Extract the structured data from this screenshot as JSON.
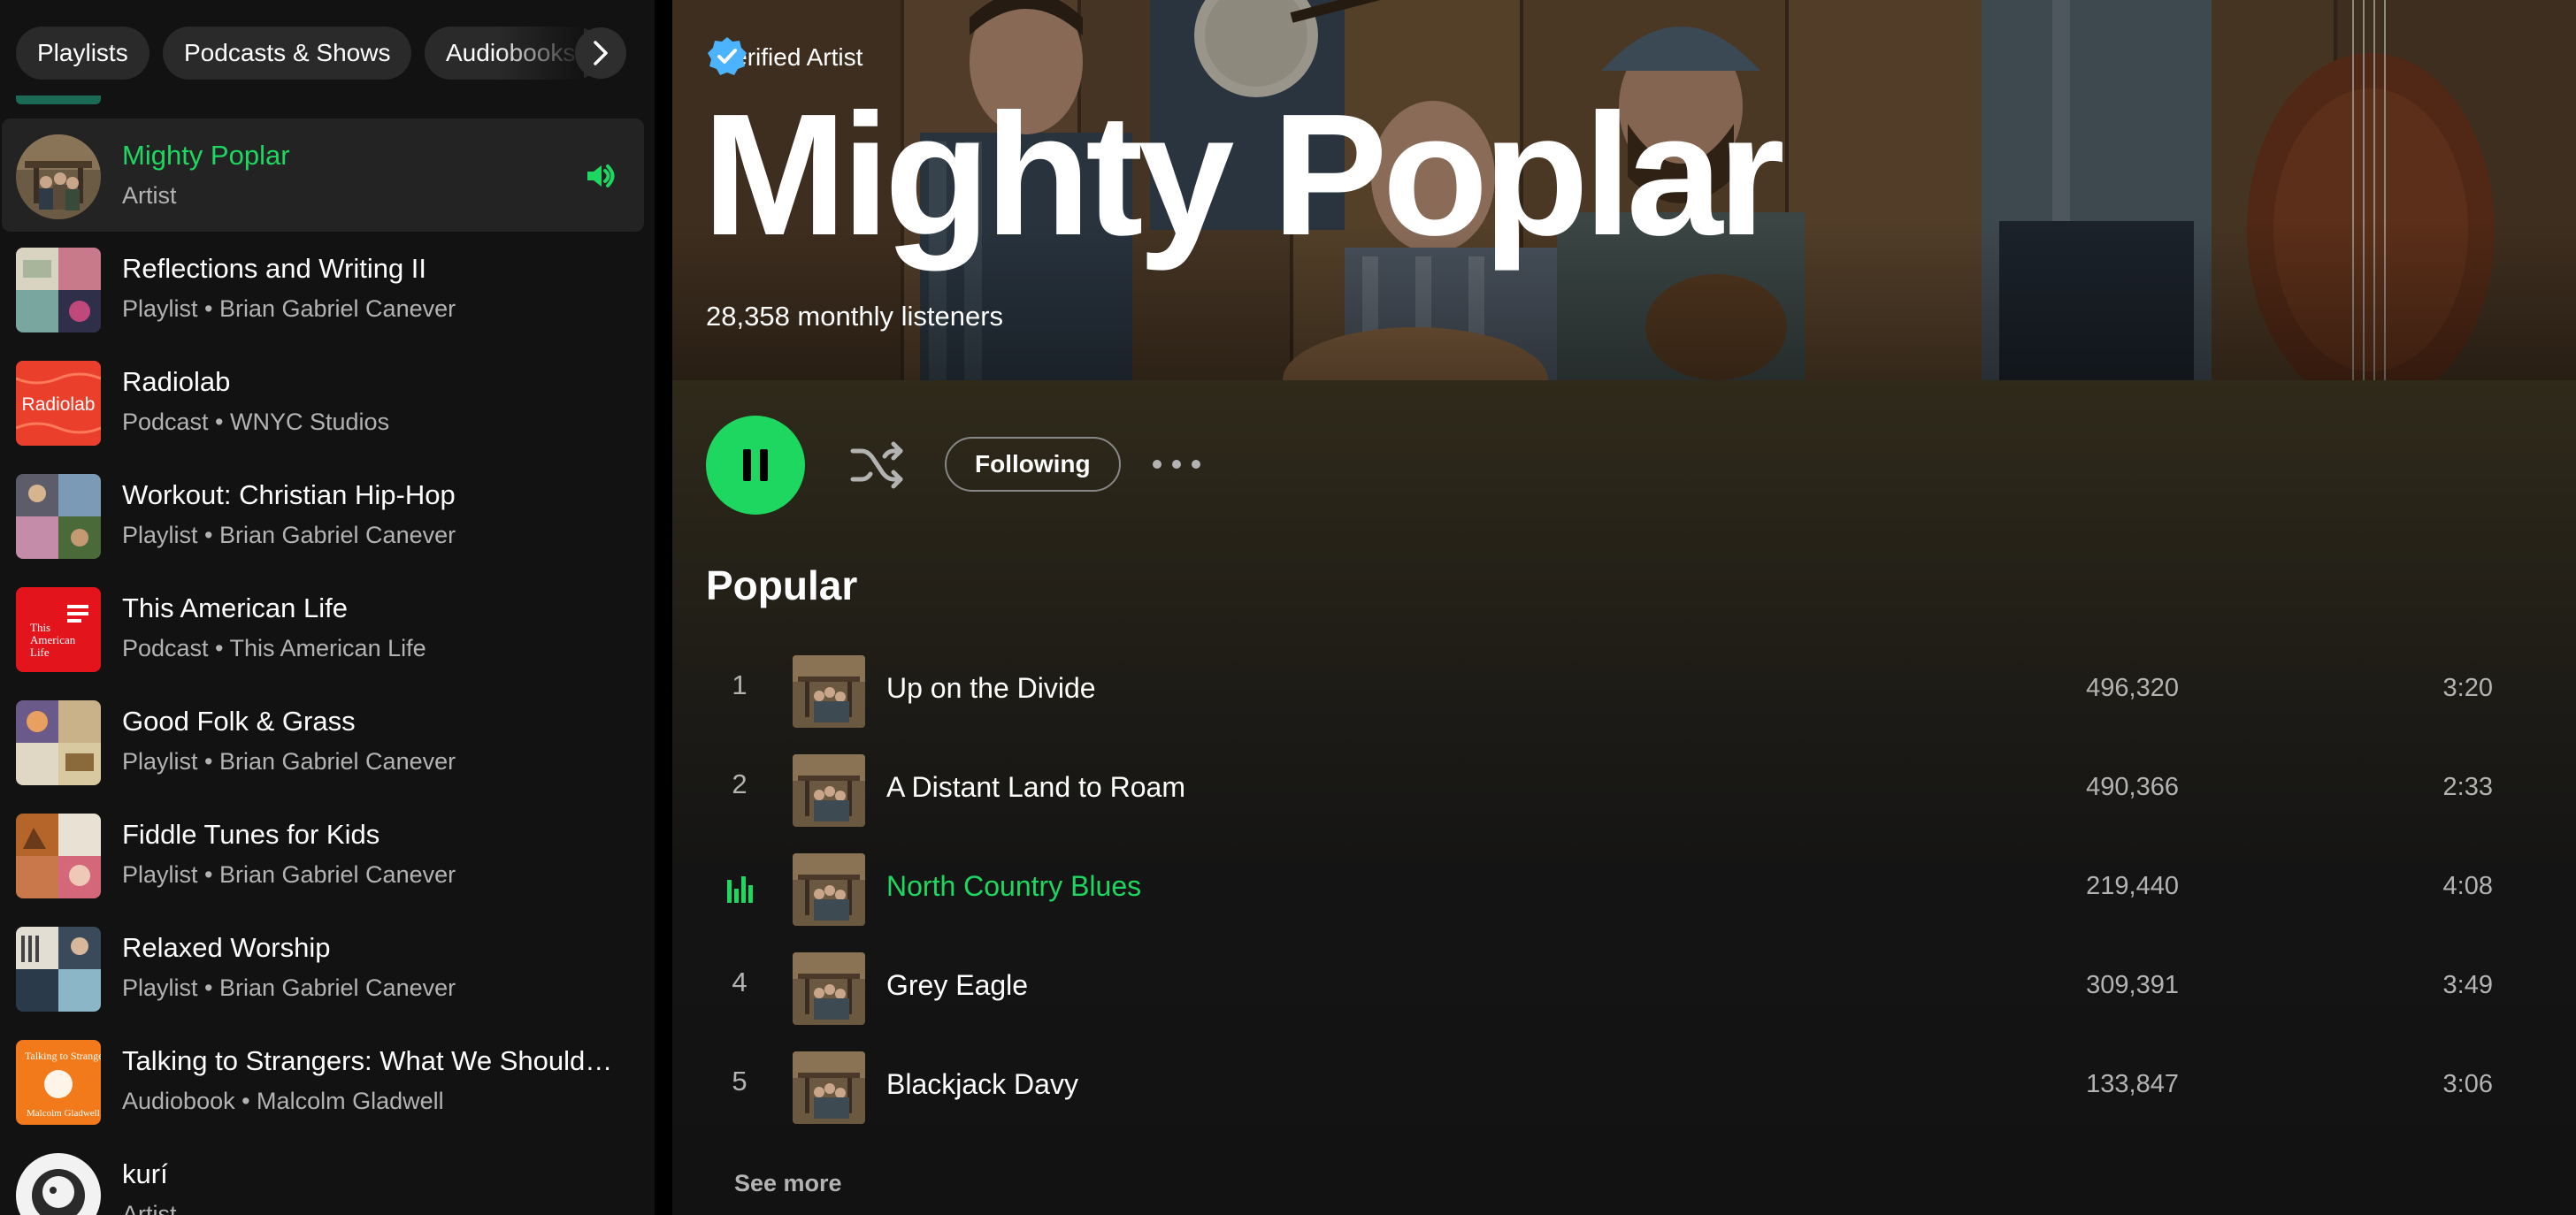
{
  "library": {
    "filters": [
      "Playlists",
      "Podcasts & Shows",
      "Audiobooks"
    ],
    "items": [
      {
        "title": "Mighty Poplar",
        "subtitle": "Artist",
        "active": true
      },
      {
        "title": "Reflections and Writing II",
        "subtitle": "Playlist • Brian Gabriel Canever"
      },
      {
        "title": "Radiolab",
        "subtitle": "Podcast • WNYC Studios",
        "thumb_text": "Radiolab"
      },
      {
        "title": "Workout: Christian Hip-Hop",
        "subtitle": "Playlist • Brian Gabriel Canever"
      },
      {
        "title": "This American Life",
        "subtitle": "Podcast • This American Life",
        "thumb_text": "This American Life"
      },
      {
        "title": "Good Folk & Grass",
        "subtitle": "Playlist • Brian Gabriel Canever"
      },
      {
        "title": "Fiddle Tunes for Kids",
        "subtitle": "Playlist • Brian Gabriel Canever"
      },
      {
        "title": "Relaxed Worship",
        "subtitle": "Playlist • Brian Gabriel Canever"
      },
      {
        "title": "Talking to Strangers: What We Should…",
        "subtitle": "Audiobook • Malcolm Gladwell",
        "thumb_text": "Talking to Strangers"
      },
      {
        "title": "kurí",
        "subtitle": "Artist"
      }
    ]
  },
  "artist": {
    "verified_label": "Verified Artist",
    "name": "Mighty Poplar",
    "monthly_listeners": "28,358 monthly listeners"
  },
  "actions": {
    "following_label": "Following"
  },
  "popular": {
    "heading": "Popular",
    "tracks": [
      {
        "num": "1",
        "title": "Up on the Divide",
        "plays": "496,320",
        "duration": "3:20"
      },
      {
        "num": "2",
        "title": "A Distant Land to Roam",
        "plays": "490,366",
        "duration": "2:33"
      },
      {
        "num": "",
        "title": "North Country Blues",
        "plays": "219,440",
        "duration": "4:08",
        "playing": true
      },
      {
        "num": "4",
        "title": "Grey Eagle",
        "plays": "309,391",
        "duration": "3:49"
      },
      {
        "num": "5",
        "title": "Blackjack Davy",
        "plays": "133,847",
        "duration": "3:06"
      }
    ],
    "see_more_label": "See more"
  },
  "colors": {
    "accent": "#1ed760",
    "background": "#121212",
    "sidebar_active": "#232323",
    "secondary_text": "#b3b3b3"
  },
  "icons": [
    "verified-badge-icon",
    "pause-icon",
    "shuffle-icon",
    "more-options-icon",
    "chevron-right-icon",
    "speaker-icon",
    "equalizer-icon"
  ]
}
